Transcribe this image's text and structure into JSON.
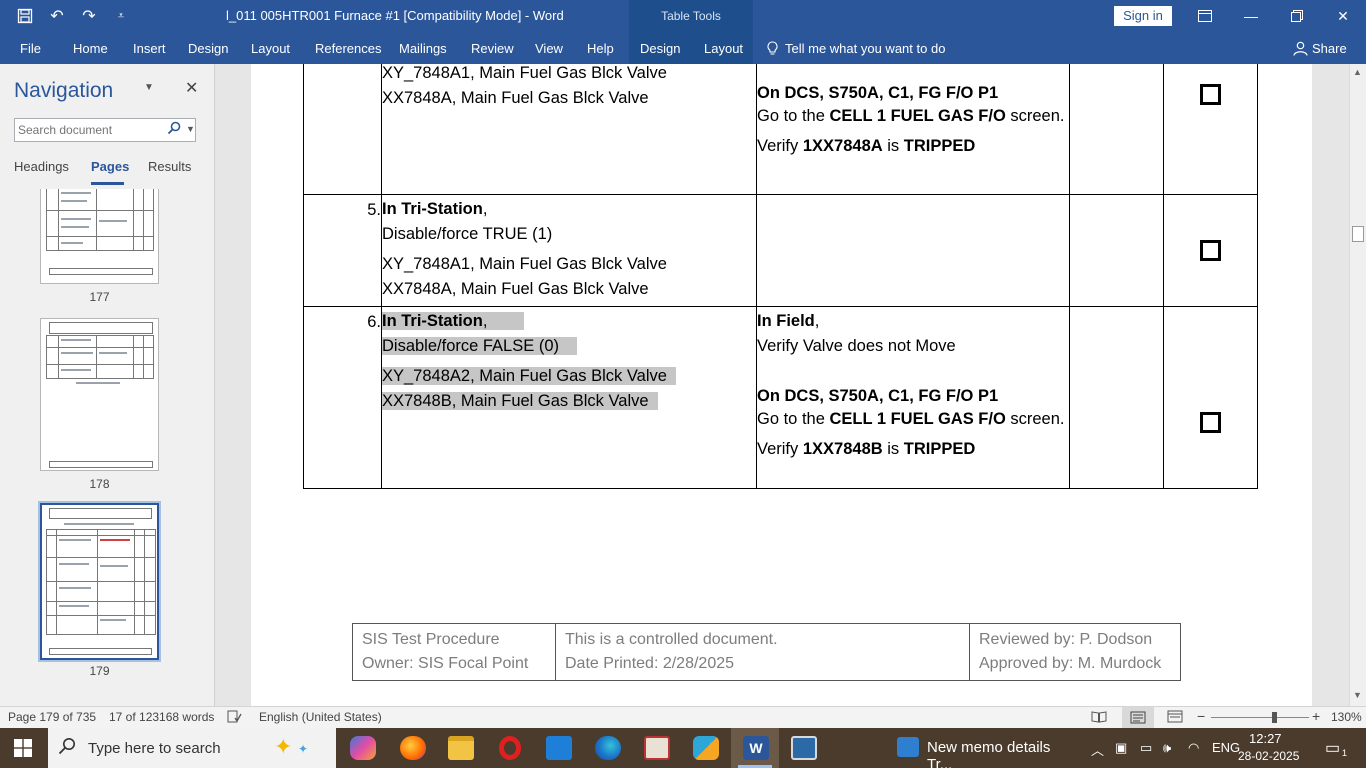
{
  "title_bar": {
    "document_title": "l_011 005HTR001 Furnace #1 [Compatibility Mode]  -  Word",
    "context_group": "Table Tools",
    "sign_in": "Sign in",
    "icons": [
      "save-icon",
      "undo-icon",
      "redo-icon",
      "customize-qat-icon",
      "ribbon-display-options-icon",
      "minimize-icon",
      "restore-icon",
      "close-icon"
    ]
  },
  "ribbon": {
    "tabs": [
      "File",
      "Home",
      "Insert",
      "Design",
      "Layout",
      "References",
      "Mailings",
      "Review",
      "View",
      "Help"
    ],
    "context_tabs": [
      "Design",
      "Layout"
    ],
    "tell_me": "Tell me what you want to do",
    "share": "Share"
  },
  "navigation": {
    "title": "Navigation",
    "search_placeholder": "Search document",
    "tabs": [
      "Headings",
      "Pages",
      "Results"
    ],
    "active_tab": "Pages",
    "pages": [
      "177",
      "178",
      "179"
    ],
    "selected_page": "179"
  },
  "procedure_table": {
    "rows": [
      {
        "step": "",
        "action_lines": [
          "XY_7848A1, Main Fuel Gas Blck Valve",
          "XX7848A, Main Fuel Gas Blck Valve"
        ],
        "verify_title": "On DCS, S750A, C1, FG F/O P1",
        "verify_pre": "Go to the ",
        "verify_bold": "CELL 1 FUEL GAS F/O",
        "verify_post": " screen.",
        "verify_line_pre": "Verify ",
        "verify_line_tag": "1XX7848A",
        "verify_line_mid": " is ",
        "verify_line_state": "TRIPPED"
      },
      {
        "step": "5.",
        "action_title": "In Tri-Station",
        "action_title_suffix": ",",
        "action_sub": "Disable/force TRUE (1)",
        "action_lines": [
          "XY_7848A1, Main Fuel Gas Blck Valve",
          "XX7848A, Main Fuel Gas Blck Valve"
        ]
      },
      {
        "step": "6.",
        "action_title": "In Tri-Station",
        "action_title_suffix": ",",
        "action_sub": "Disable/force FALSE (0)",
        "action_lines": [
          "XY_7848A2, Main Fuel Gas Blck Valve",
          "XX7848B, Main Fuel Gas Blck Valve"
        ],
        "field_title": "In Field",
        "field_title_suffix": ",",
        "field_line": "Verify Valve does not Move",
        "verify_title": "On DCS, S750A, C1, FG F/O P1",
        "verify_pre": "Go to the ",
        "verify_bold": "CELL 1 FUEL GAS F/O",
        "verify_post": " screen.",
        "verify_line_pre": "Verify ",
        "verify_line_tag": "1XX7848B",
        "verify_line_mid": " is ",
        "verify_line_state": "TRIPPED"
      }
    ]
  },
  "footer": {
    "left": [
      "SIS Test Procedure",
      "Owner: SIS Focal Point"
    ],
    "middle": [
      "This is a controlled document.",
      "Date Printed: 2/28/2025"
    ],
    "right": [
      "Reviewed by: P. Dodson",
      "Approved by: M. Murdock"
    ]
  },
  "status_bar": {
    "page": "Page 179 of 735",
    "words": "17 of 123168 words",
    "language": "English (United States)",
    "zoom": "130%",
    "zoom_fraction": 0.62
  },
  "taskbar": {
    "search_placeholder": "Type here to search",
    "memo_text": "New memo details Tr...",
    "lang": "ENG",
    "time": "12:27",
    "date": "28-02-2025",
    "notification_count": "1"
  },
  "colors": {
    "word_blue": "#2b579a",
    "context_blue": "#1f4e8c",
    "selection_gray": "#c6c6c6",
    "taskbar": "#4a3b2c"
  }
}
